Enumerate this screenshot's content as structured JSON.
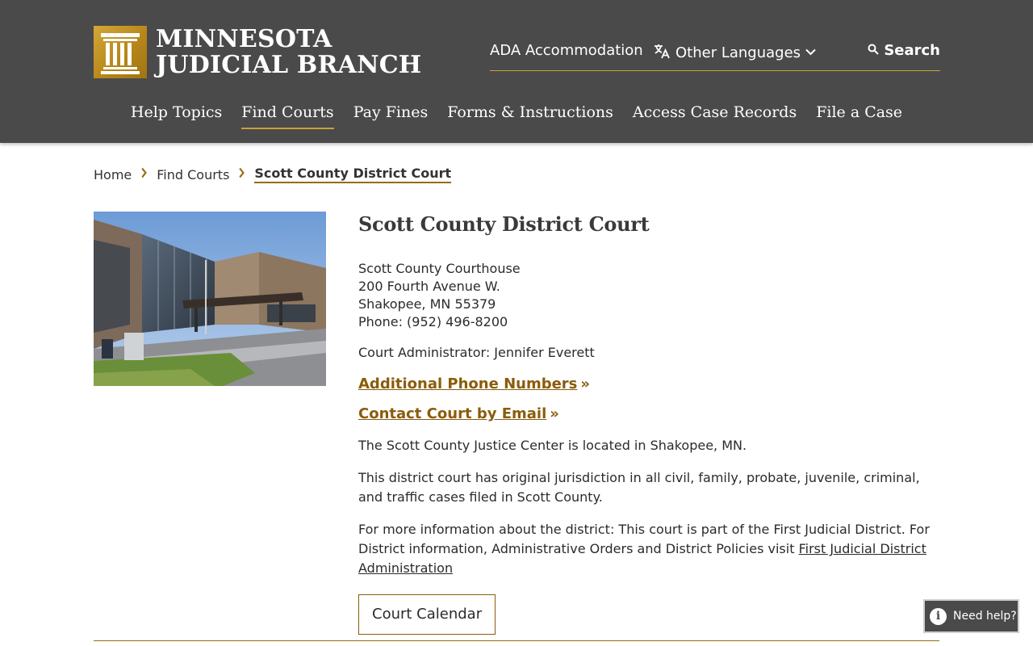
{
  "header": {
    "logo_line1": "MINNESOTA",
    "logo_line2": "JUDICIAL BRANCH",
    "utility": {
      "ada": "ADA Accommodation",
      "languages": "Other Languages",
      "search": "Search"
    },
    "nav": [
      {
        "label": "Help Topics",
        "active": false
      },
      {
        "label": "Find Courts",
        "active": true
      },
      {
        "label": "Pay Fines",
        "active": false
      },
      {
        "label": "Forms & Instructions",
        "active": false
      },
      {
        "label": "Access Case Records",
        "active": false
      },
      {
        "label": "File a Case",
        "active": false
      }
    ]
  },
  "breadcrumb": {
    "items": [
      "Home",
      "Find Courts"
    ],
    "current": "Scott County District Court"
  },
  "court": {
    "title": "Scott County District Court",
    "address_name": "Scott County Courthouse",
    "address_street": "200 Fourth Avenue W.",
    "address_city": "Shakopee, MN 55379",
    "phone": "Phone: (952) 496-8200",
    "administrator": "Court Administrator: Jennifer Everett",
    "link_phone": "Additional Phone Numbers",
    "link_email": "Contact Court by Email",
    "link_arrow": "»",
    "para_location": "The Scott County Justice Center is located in Shakopee, MN.",
    "para_jurisdiction": "This district court has original jurisdiction in all civil, family, probate, juvenile, criminal, and traffic cases filed in Scott County.",
    "para_district": "For more information about the district: This court is part of the First Judicial District. For District information, Administrative Orders and District Policies visit",
    "para_district_link": "First Judicial District Administration",
    "calendar_button": "Court Calendar"
  },
  "help_widget": {
    "label": "Need help?"
  },
  "colors": {
    "header_bg": "#4a4a4a",
    "accent_gold": "#c9a13a",
    "link_brown": "#8a5c0b"
  }
}
